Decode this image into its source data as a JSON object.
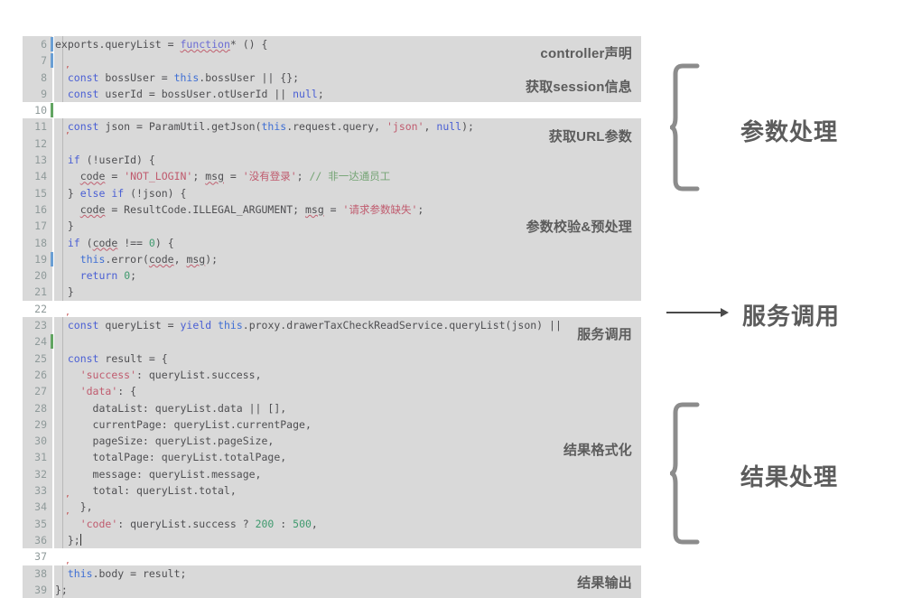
{
  "editor": {
    "blocks": [
      {
        "id": "block-declaration",
        "separator": false,
        "annotation": "controller声明",
        "lines": [
          {
            "no": "6",
            "gutter": "blue",
            "tokens": [
              {
                "t": "exports.queryList = ",
                "c": "plain"
              },
              {
                "t": "function",
                "c": "kw2 und"
              },
              {
                "t": "* () {",
                "c": "plain"
              }
            ]
          },
          {
            "no": "7",
            "gutter": "blue",
            "redtick": false,
            "tokens": []
          }
        ]
      },
      {
        "id": "block-session",
        "separator": false,
        "annotation": "获取session信息",
        "lines": [
          {
            "no": "8",
            "redtick": true,
            "tokens": [
              {
                "t": "  ",
                "c": "plain"
              },
              {
                "t": "const",
                "c": "kw"
              },
              {
                "t": " bossUser = ",
                "c": "plain"
              },
              {
                "t": "this",
                "c": "ths"
              },
              {
                "t": ".bossUser || {};",
                "c": "plain"
              }
            ]
          },
          {
            "no": "9",
            "tokens": [
              {
                "t": "  ",
                "c": "plain"
              },
              {
                "t": "const",
                "c": "kw"
              },
              {
                "t": " userId = bossUser.otUserId || ",
                "c": "plain"
              },
              {
                "t": "null",
                "c": "kw"
              },
              {
                "t": ";",
                "c": "plain"
              }
            ]
          }
        ]
      },
      {
        "id": "block-sep-10",
        "separator": true,
        "annotation": "",
        "lines": [
          {
            "no": "10",
            "gutter": "green",
            "tokens": []
          }
        ]
      },
      {
        "id": "block-url-params",
        "separator": false,
        "annotation": "获取URL参数",
        "lines": [
          {
            "no": "11",
            "tokens": [
              {
                "t": "  ",
                "c": "plain"
              },
              {
                "t": "const",
                "c": "kw"
              },
              {
                "t": " json = ParamUtil.getJson(",
                "c": "plain"
              },
              {
                "t": "this",
                "c": "ths"
              },
              {
                "t": ".request.query, ",
                "c": "plain"
              },
              {
                "t": "'json'",
                "c": "str"
              },
              {
                "t": ", ",
                "c": "plain"
              },
              {
                "t": "null",
                "c": "kw"
              },
              {
                "t": ");",
                "c": "plain"
              }
            ]
          },
          {
            "no": "12",
            "redtick": true,
            "tokens": []
          }
        ]
      },
      {
        "id": "block-validation",
        "separator": false,
        "annotation": "参数校验&预处理",
        "lines": [
          {
            "no": "13",
            "tokens": [
              {
                "t": "  ",
                "c": "plain"
              },
              {
                "t": "if",
                "c": "kw"
              },
              {
                "t": " (!userId) {",
                "c": "plain"
              }
            ]
          },
          {
            "no": "14",
            "tokens": [
              {
                "t": "    ",
                "c": "plain"
              },
              {
                "t": "code",
                "c": "plain und"
              },
              {
                "t": " = ",
                "c": "plain"
              },
              {
                "t": "'NOT_LOGIN'",
                "c": "str"
              },
              {
                "t": "; ",
                "c": "plain"
              },
              {
                "t": "msg",
                "c": "plain und"
              },
              {
                "t": " = ",
                "c": "plain"
              },
              {
                "t": "'没有登录'",
                "c": "str"
              },
              {
                "t": "; ",
                "c": "plain"
              },
              {
                "t": "// 非一达通员工",
                "c": "com"
              }
            ]
          },
          {
            "no": "15",
            "tokens": [
              {
                "t": "  } ",
                "c": "plain"
              },
              {
                "t": "else",
                "c": "kw"
              },
              {
                "t": " ",
                "c": "plain"
              },
              {
                "t": "if",
                "c": "kw"
              },
              {
                "t": " (!json) {",
                "c": "plain"
              }
            ]
          },
          {
            "no": "16",
            "tokens": [
              {
                "t": "    ",
                "c": "plain"
              },
              {
                "t": "code",
                "c": "plain und"
              },
              {
                "t": " = ResultCode.ILLEGAL_ARGUMENT; ",
                "c": "plain"
              },
              {
                "t": "msg",
                "c": "plain und"
              },
              {
                "t": " = ",
                "c": "plain"
              },
              {
                "t": "'请求参数缺失'",
                "c": "str"
              },
              {
                "t": ";",
                "c": "plain"
              }
            ]
          },
          {
            "no": "17",
            "tokens": [
              {
                "t": "  }",
                "c": "plain"
              }
            ]
          },
          {
            "no": "18",
            "tokens": [
              {
                "t": "  ",
                "c": "plain"
              },
              {
                "t": "if",
                "c": "kw"
              },
              {
                "t": " (",
                "c": "plain"
              },
              {
                "t": "code",
                "c": "plain und"
              },
              {
                "t": " !== ",
                "c": "plain"
              },
              {
                "t": "0",
                "c": "num"
              },
              {
                "t": ") {",
                "c": "plain"
              }
            ]
          },
          {
            "no": "19",
            "gutter": "blue",
            "tokens": [
              {
                "t": "    ",
                "c": "plain"
              },
              {
                "t": "this",
                "c": "ths"
              },
              {
                "t": ".error(",
                "c": "plain"
              },
              {
                "t": "code",
                "c": "plain und"
              },
              {
                "t": ", ",
                "c": "plain"
              },
              {
                "t": "msg",
                "c": "plain und"
              },
              {
                "t": ");",
                "c": "plain"
              }
            ]
          },
          {
            "no": "20",
            "tokens": [
              {
                "t": "    ",
                "c": "plain"
              },
              {
                "t": "return",
                "c": "kw"
              },
              {
                "t": " ",
                "c": "plain"
              },
              {
                "t": "0",
                "c": "num"
              },
              {
                "t": ";",
                "c": "plain"
              }
            ]
          },
          {
            "no": "21",
            "tokens": [
              {
                "t": "  }",
                "c": "plain"
              }
            ]
          }
        ]
      },
      {
        "id": "block-sep-22",
        "separator": true,
        "annotation": "",
        "lines": [
          {
            "no": "22",
            "tokens": []
          }
        ]
      },
      {
        "id": "block-service-call",
        "separator": false,
        "annotation": "服务调用",
        "lines": [
          {
            "no": "23",
            "redtick": true,
            "tokens": [
              {
                "t": "  ",
                "c": "plain"
              },
              {
                "t": "const",
                "c": "kw"
              },
              {
                "t": " queryList = ",
                "c": "plain"
              },
              {
                "t": "yield",
                "c": "kw"
              },
              {
                "t": " ",
                "c": "plain"
              },
              {
                "t": "this",
                "c": "ths"
              },
              {
                "t": ".proxy.drawerTaxCheckReadService.queryList(json) ||",
                "c": "plain"
              }
            ]
          },
          {
            "no": "24",
            "gutter": "green",
            "tokens": []
          }
        ]
      },
      {
        "id": "block-result-format",
        "separator": false,
        "annotation": "结果格式化",
        "lines": [
          {
            "no": "25",
            "tokens": [
              {
                "t": "  ",
                "c": "plain"
              },
              {
                "t": "const",
                "c": "kw"
              },
              {
                "t": " result = {",
                "c": "plain"
              }
            ]
          },
          {
            "no": "26",
            "tokens": [
              {
                "t": "    ",
                "c": "plain"
              },
              {
                "t": "'success'",
                "c": "str"
              },
              {
                "t": ": queryList.success,",
                "c": "plain"
              }
            ]
          },
          {
            "no": "27",
            "tokens": [
              {
                "t": "    ",
                "c": "plain"
              },
              {
                "t": "'data'",
                "c": "str"
              },
              {
                "t": ": {",
                "c": "plain"
              }
            ]
          },
          {
            "no": "28",
            "tokens": [
              {
                "t": "      dataList: queryList.data || [],",
                "c": "plain"
              }
            ]
          },
          {
            "no": "29",
            "tokens": [
              {
                "t": "      currentPage: queryList.currentPage,",
                "c": "plain"
              }
            ]
          },
          {
            "no": "30",
            "tokens": [
              {
                "t": "      pageSize: queryList.pageSize,",
                "c": "plain"
              }
            ]
          },
          {
            "no": "31",
            "tokens": [
              {
                "t": "      totalPage: queryList.totalPage,",
                "c": "plain"
              }
            ]
          },
          {
            "no": "32",
            "tokens": [
              {
                "t": "      message: queryList.message,",
                "c": "plain"
              }
            ]
          },
          {
            "no": "33",
            "tokens": [
              {
                "t": "      total: queryList.total,",
                "c": "plain"
              }
            ]
          },
          {
            "no": "34",
            "redtick": true,
            "tokens": [
              {
                "t": "    },",
                "c": "plain"
              }
            ]
          },
          {
            "no": "35",
            "redtick": true,
            "tokens": [
              {
                "t": "    ",
                "c": "plain"
              },
              {
                "t": "'code'",
                "c": "str"
              },
              {
                "t": ": queryList.success ? ",
                "c": "plain"
              },
              {
                "t": "200",
                "c": "num"
              },
              {
                "t": " : ",
                "c": "plain"
              },
              {
                "t": "500",
                "c": "num"
              },
              {
                "t": ",",
                "c": "plain"
              }
            ]
          },
          {
            "no": "36",
            "caret": true,
            "tokens": [
              {
                "t": "  };",
                "c": "plain"
              }
            ]
          }
        ]
      },
      {
        "id": "block-sep-37",
        "separator": true,
        "annotation": "",
        "lines": [
          {
            "no": "37",
            "tokens": []
          }
        ]
      },
      {
        "id": "block-result-output",
        "separator": false,
        "annotation": "结果输出",
        "lines": [
          {
            "no": "38",
            "redtick": true,
            "tokens": [
              {
                "t": "  ",
                "c": "plain"
              },
              {
                "t": "this",
                "c": "ths"
              },
              {
                "t": ".body = result;",
                "c": "plain"
              }
            ]
          },
          {
            "no": "39",
            "tokens": [
              {
                "t": "};",
                "c": "plain"
              }
            ]
          }
        ]
      }
    ]
  },
  "annotations": {
    "param_handling": "参数处理",
    "service_call": "服务调用",
    "result_handling": "结果处理"
  },
  "colors": {
    "code_background": "#d9d9d9",
    "separator": "#ffffff",
    "annotation_text": "#5c5c5c",
    "brace": "#8c8c8c",
    "keyword": "#4a5fd4",
    "string": "#c05b6e",
    "comment": "#74a474",
    "number": "#3f9a6e",
    "line_number": "#8f9a9a"
  }
}
